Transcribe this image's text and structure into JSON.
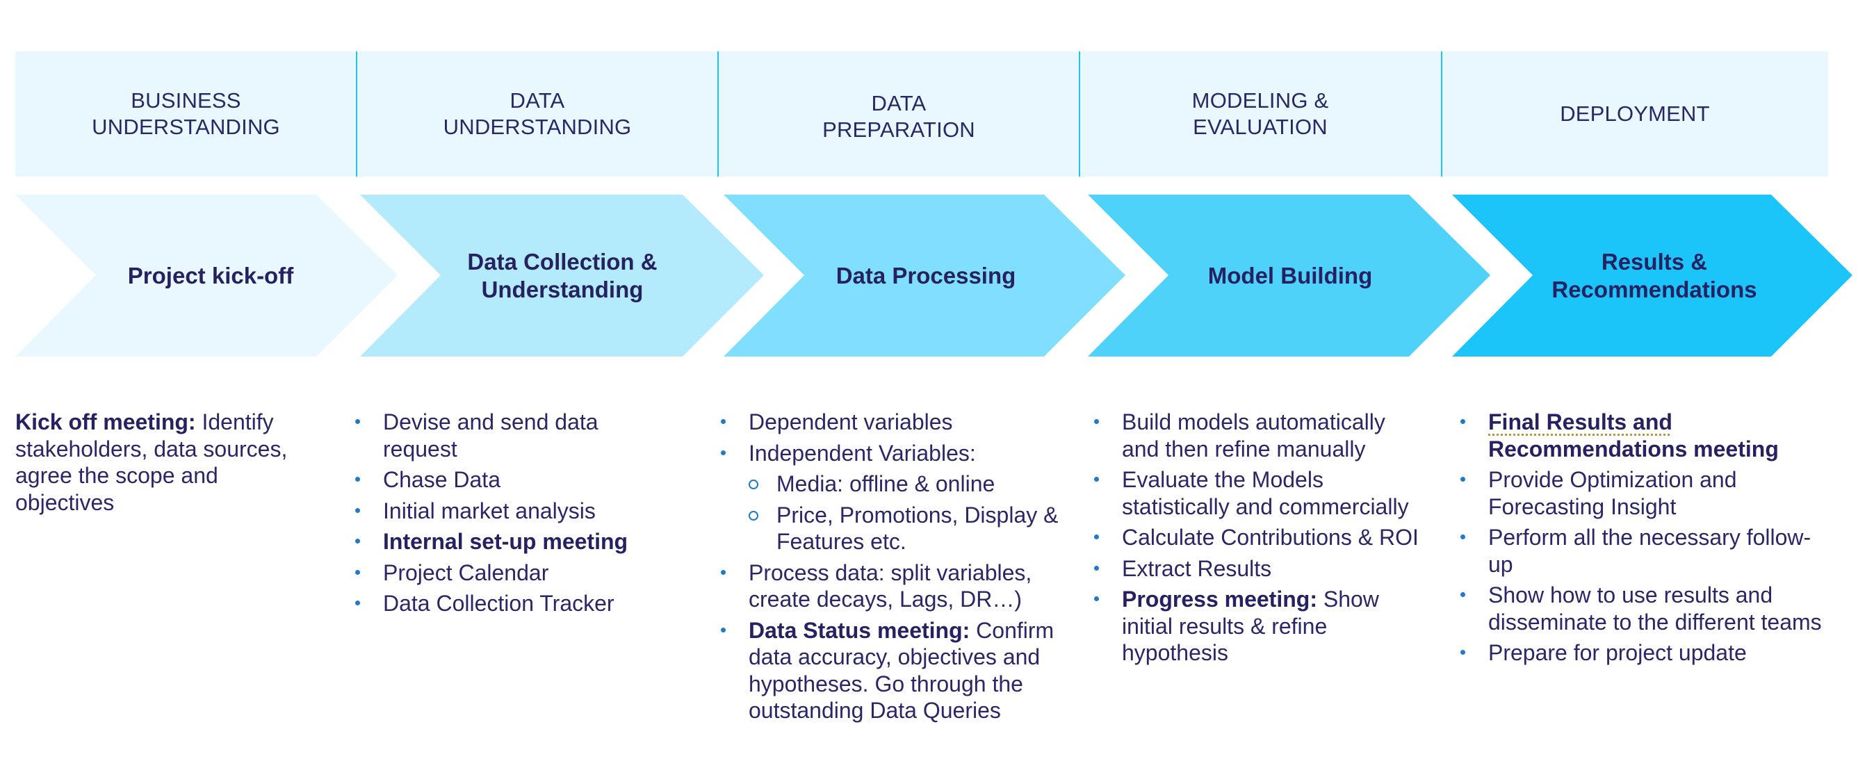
{
  "phases": [
    {
      "header": "BUSINESS\nUNDERSTANDING",
      "header_lines": [
        "BUSINESS",
        "UNDERSTANDING"
      ],
      "step": "Project kick-off",
      "color": "#E8F8FE"
    },
    {
      "header": "DATA\nUNDERSTANDING",
      "header_lines": [
        "DATA",
        "UNDERSTANDING"
      ],
      "step": "Data Collection &\nUnderstanding",
      "color": "#B3EBFC"
    },
    {
      "header": "DATA\nPREPARATION",
      "header_lines": [
        "DATA",
        "PREPARATION"
      ],
      "step": "Data Processing",
      "color": "#80DFFD"
    },
    {
      "header": "MODELING &\nEVALUATION",
      "header_lines": [
        "MODELING &",
        "EVALUATION"
      ],
      "step": "Model Building",
      "color": "#4FD2FA"
    },
    {
      "header": "DEPLOYMENT",
      "header_lines": [
        "DEPLOYMENT"
      ],
      "step": "Results &\nRecommendations",
      "color": "#1CC5F9"
    }
  ],
  "colors": {
    "header_bg": "#E8F8FE",
    "divider": "#1EC5F0",
    "text": "#262262",
    "bullet": "#1F7BC8"
  },
  "details": {
    "business": {
      "bold": "Kick off meeting:",
      "text": " Identify stakeholders, data sources, agree the scope and objectives"
    },
    "data_understanding": [
      {
        "text": "Devise and send data request"
      },
      {
        "text": "Chase Data"
      },
      {
        "text": "Initial market analysis"
      },
      {
        "bold": "Internal set-up meeting"
      },
      {
        "text": "Project Calendar"
      },
      {
        "text": "Data Collection Tracker"
      }
    ],
    "data_preparation": [
      {
        "text": "Dependent variables"
      },
      {
        "text": "Independent Variables:"
      },
      {
        "sub": true,
        "text": "Media: offline & online"
      },
      {
        "sub": true,
        "text": "Price, Promotions, Display & Features etc."
      },
      {
        "text": "Process data: split variables, create decays, Lags, DR…)"
      },
      {
        "bold": "Data  Status meeting:",
        "text": " Confirm data accuracy, objectives and hypotheses. Go through the outstanding Data Queries"
      }
    ],
    "modeling": [
      {
        "text": "Build models automatically and then refine manually"
      },
      {
        "text": "Evaluate the Models statistically and commercially"
      },
      {
        "text": "Calculate Contributions & ROI"
      },
      {
        "text": "Extract Results"
      },
      {
        "bold": "Progress meeting:",
        "text": " Show initial results & refine hypothesis"
      }
    ],
    "deployment": [
      {
        "bold": "Final Results and",
        "bold2": " Recommendations meeting"
      },
      {
        "text": "Provide  Optimization and Forecasting Insight"
      },
      {
        "text": "Perform all the necessary follow-up"
      },
      {
        "text": "Show how to use results and disseminate to the different teams"
      },
      {
        "text": "Prepare for project update"
      }
    ]
  }
}
